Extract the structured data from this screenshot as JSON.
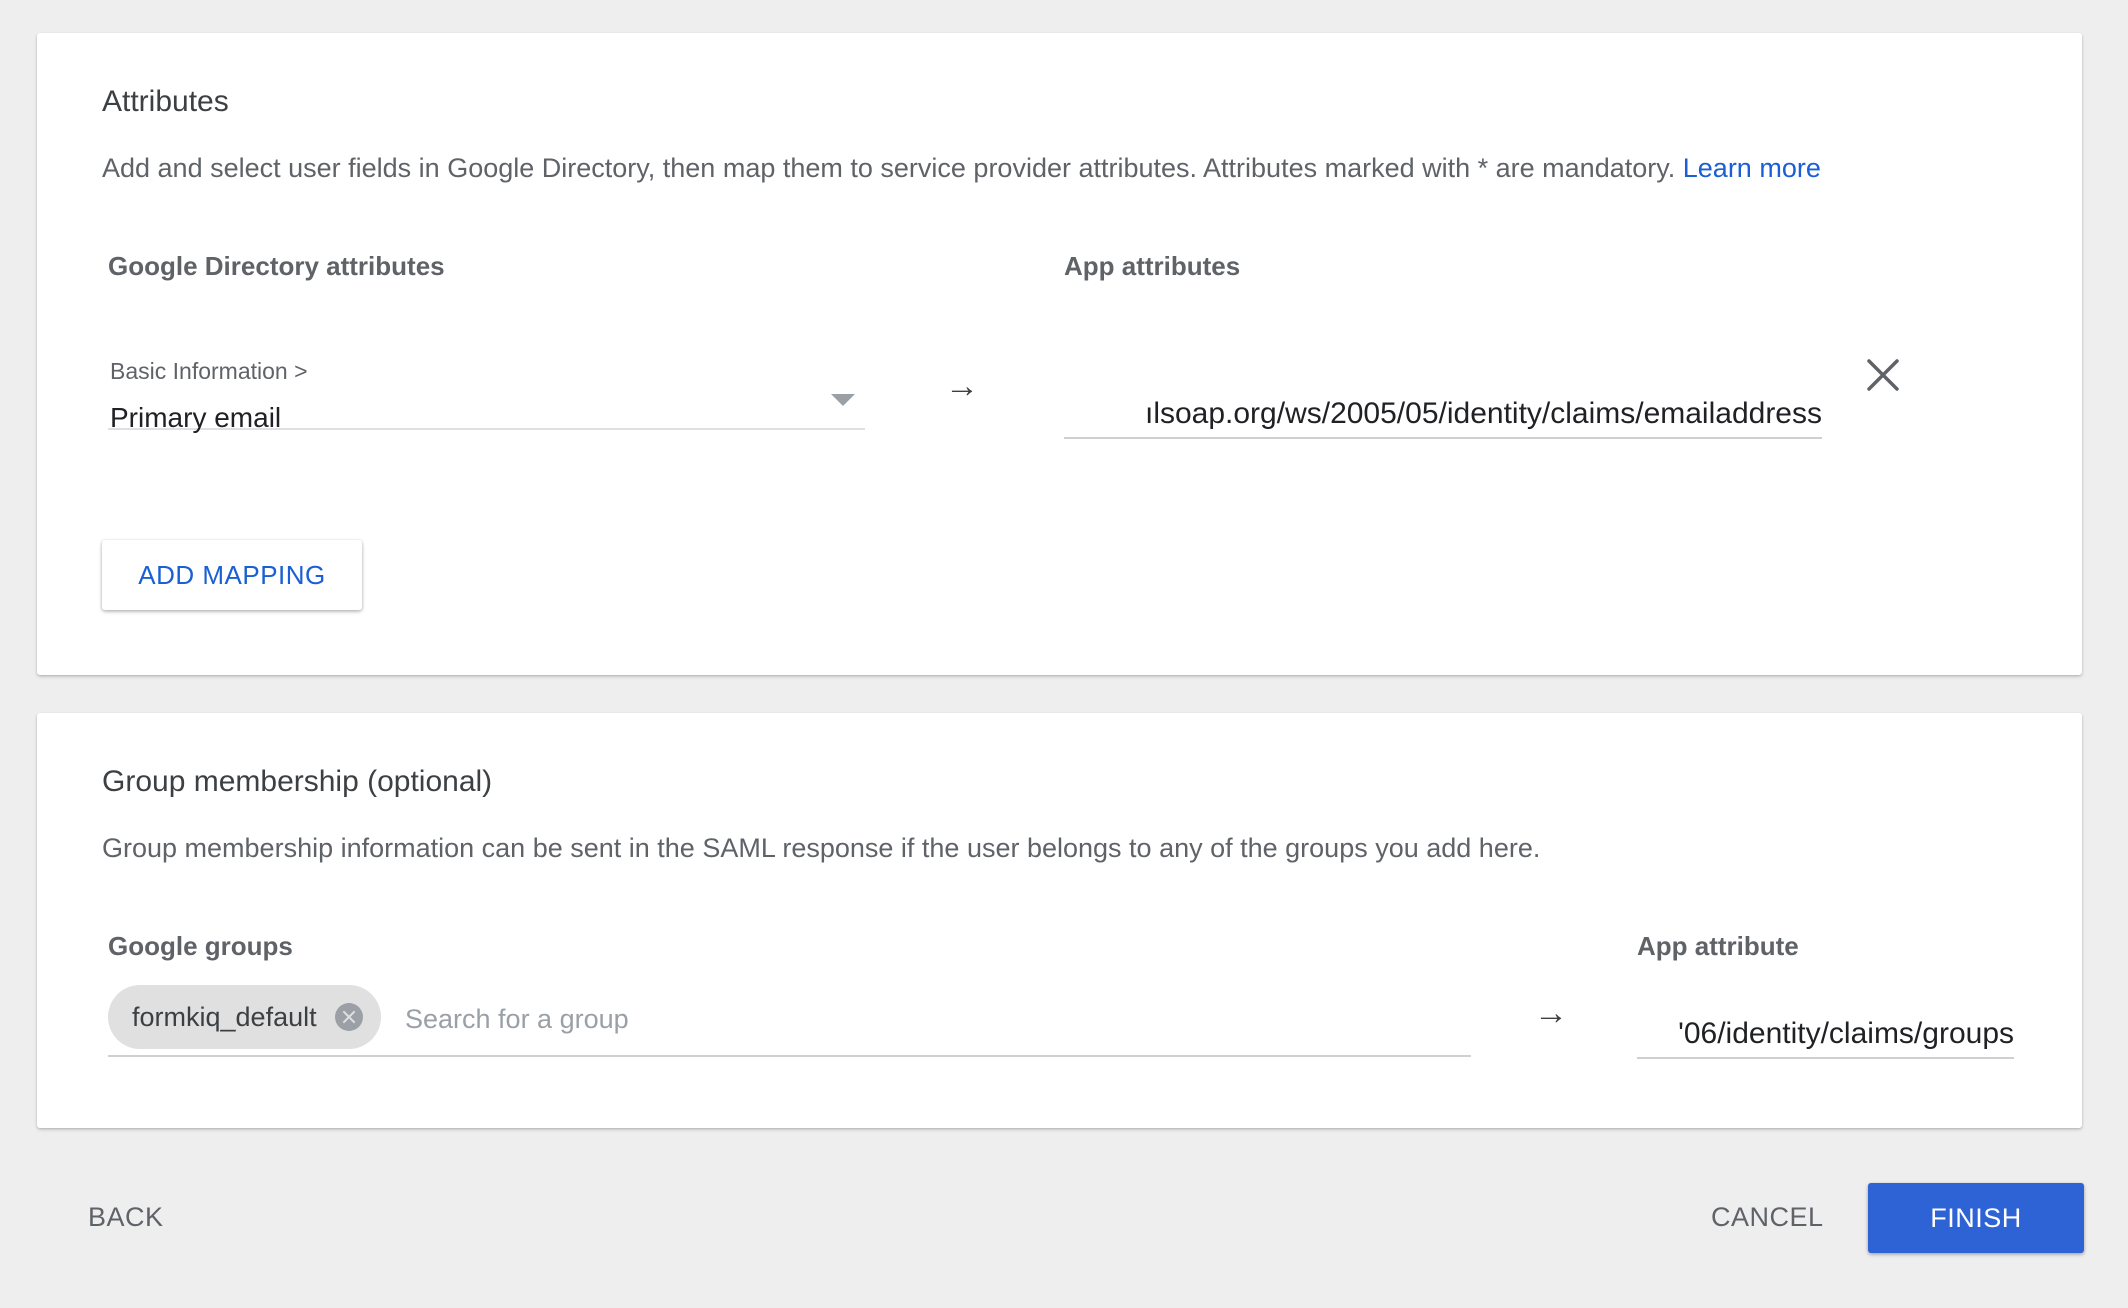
{
  "attributes": {
    "title": "Attributes",
    "description": "Add and select user fields in Google Directory, then map them to service provider attributes. Attributes marked with * are mandatory.",
    "learn_more": "Learn more",
    "col_directory": "Google Directory attributes",
    "col_app": "App attributes",
    "mapping": {
      "breadcrumb": "Basic Information >",
      "selected_field": "Primary email",
      "arrow": "→",
      "app_value": "ılsoap.org/ws/2005/05/identity/claims/emailaddress",
      "remove_icon": "close-icon"
    },
    "add_mapping_label": "ADD MAPPING"
  },
  "groups": {
    "title": "Group membership (optional)",
    "description": "Group membership information can be sent in the SAML response if the user belongs to any of the groups you add here.",
    "col_groups": "Google groups",
    "col_app": "App attribute",
    "chips": [
      "formkiq_default"
    ],
    "search_placeholder": "Search for a group",
    "arrow": "→",
    "app_value": "'06/identity/claims/groups"
  },
  "footer": {
    "back_label": "BACK",
    "cancel_label": "CANCEL",
    "finish_label": "FINISH"
  },
  "colors": {
    "accent": "#2d63d5",
    "link": "#1a5fd3",
    "background": "#eeeeee"
  }
}
